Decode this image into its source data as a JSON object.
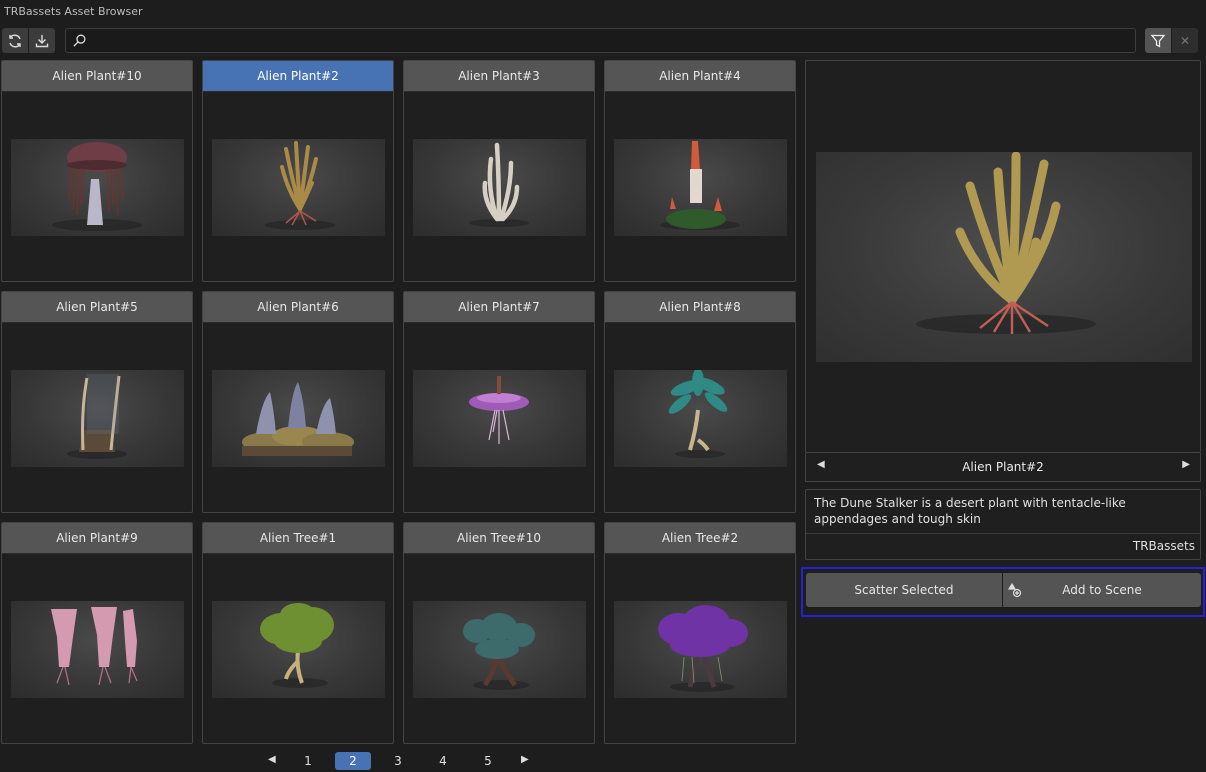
{
  "window": {
    "title": "TRBassets Asset Browser"
  },
  "toolbar": {
    "refresh_icon": "refresh-icon",
    "download_icon": "download-icon",
    "filter_icon": "filter-icon",
    "clear_icon": "close-icon",
    "clear_symbol": "✕"
  },
  "search": {
    "value": "",
    "placeholder": ""
  },
  "grid": {
    "items": [
      {
        "label": "Alien Plant#10"
      },
      {
        "label": "Alien Plant#2"
      },
      {
        "label": "Alien Plant#3"
      },
      {
        "label": "Alien Plant#4"
      },
      {
        "label": "Alien Plant#5"
      },
      {
        "label": "Alien Plant#6"
      },
      {
        "label": "Alien Plant#7"
      },
      {
        "label": "Alien Plant#8"
      },
      {
        "label": "Alien Plant#9"
      },
      {
        "label": "Alien Tree#1"
      },
      {
        "label": "Alien Tree#10"
      },
      {
        "label": "Alien Tree#2"
      }
    ],
    "selected_index": 1
  },
  "preview": {
    "name": "Alien Plant#2",
    "prev_symbol": "◀",
    "next_symbol": "▶",
    "description": "The Dune Stalker is a desert plant with tentacle-like appendages and tough skin",
    "author": "TRBassets"
  },
  "actions": {
    "scatter_label": "Scatter Selected",
    "add_label": "Add to Scene",
    "add_icon": "add-object-icon"
  },
  "pagination": {
    "prev_symbol": "◀",
    "next_symbol": "▶",
    "pages": [
      "1",
      "2",
      "3",
      "4",
      "5"
    ],
    "current": "2"
  },
  "colors": {
    "accent": "#4772b3",
    "highlight_border": "#2b1fd6",
    "background": "#1d1d1d",
    "card_header": "#555555"
  }
}
